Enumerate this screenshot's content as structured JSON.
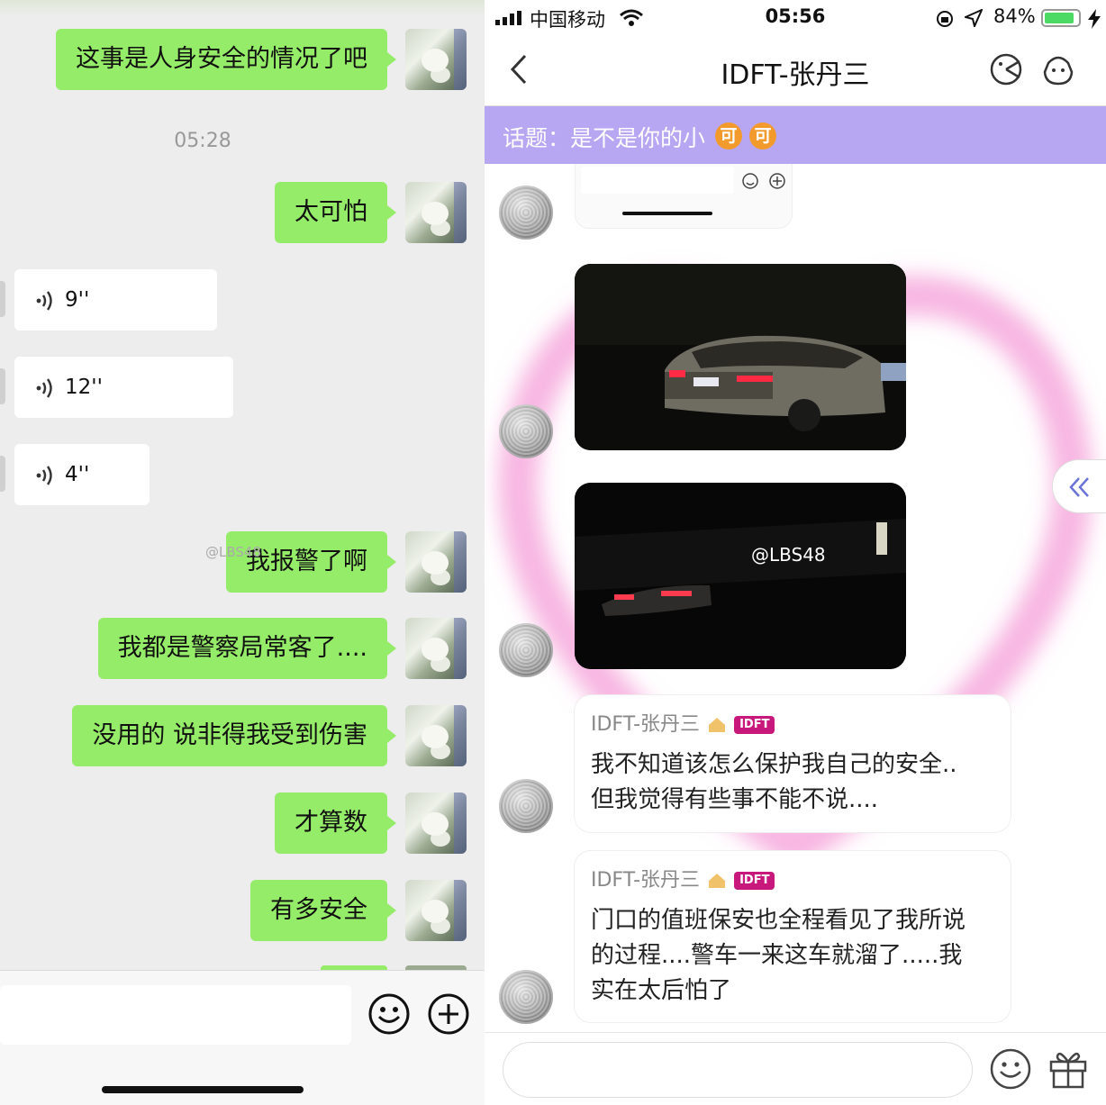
{
  "left": {
    "messages": [
      {
        "type": "text",
        "text": "这事是人身安全的情况了吧"
      },
      {
        "type": "time",
        "text": "05:28"
      },
      {
        "type": "text",
        "text": "太可怕"
      },
      {
        "type": "voice",
        "text": "9''"
      },
      {
        "type": "voice",
        "text": "12''"
      },
      {
        "type": "voice",
        "text": "4''"
      },
      {
        "type": "text",
        "text": "我报警了啊"
      },
      {
        "type": "text",
        "text": "我都是警察局常客了...."
      },
      {
        "type": "text",
        "text": "没用的 说非得我受到伤害"
      },
      {
        "type": "text",
        "text": "才算数"
      },
      {
        "type": "text",
        "text": "有多安全"
      }
    ],
    "watermark": "@LBS48"
  },
  "right": {
    "status": {
      "carrier": "中国移动",
      "time": "05:56",
      "battery": "84%"
    },
    "nav": {
      "title": "IDFT-张丹三"
    },
    "topic": {
      "label": "话题：是不是你的小",
      "tags": [
        "可",
        "可"
      ]
    },
    "photo_watermark": "@LBS48",
    "cards": [
      {
        "name": "IDFT-张丹三",
        "badge": "IDFT",
        "body": "我不知道该怎么保护我自己的安全..\n但我觉得有些事不能不说...."
      },
      {
        "name": "IDFT-张丹三",
        "badge": "IDFT",
        "body": "门口的值班保安也全程看见了我所说\n的过程....警车一来这车就溜了.....我\n实在太后怕了"
      }
    ]
  },
  "colors": {
    "wechat_green": "#95ec69",
    "topic_purple": "#aa96f0",
    "badge_magenta": "#c8187c",
    "heart_pink": "#f49ad6"
  }
}
